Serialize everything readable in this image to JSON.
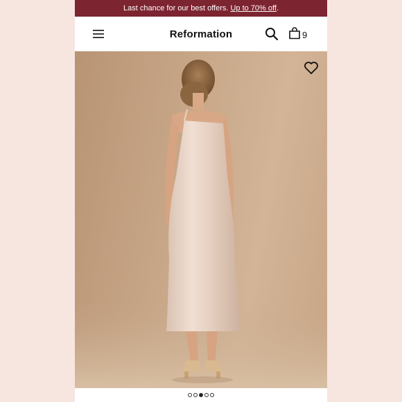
{
  "promo": {
    "text": "Last chance for our best offers.",
    "link_text": "Up to 70% off",
    "suffix": ".",
    "bg_color": "#7d2431"
  },
  "header": {
    "brand": "Reformation",
    "menu_icon": "menu-icon",
    "search_icon": "search-icon",
    "bag_icon": "shopping-bag-icon",
    "bag_count": "9"
  },
  "product_image": {
    "favorite_icon": "heart-icon",
    "carousel": {
      "total": 5,
      "active_index": 2
    }
  }
}
